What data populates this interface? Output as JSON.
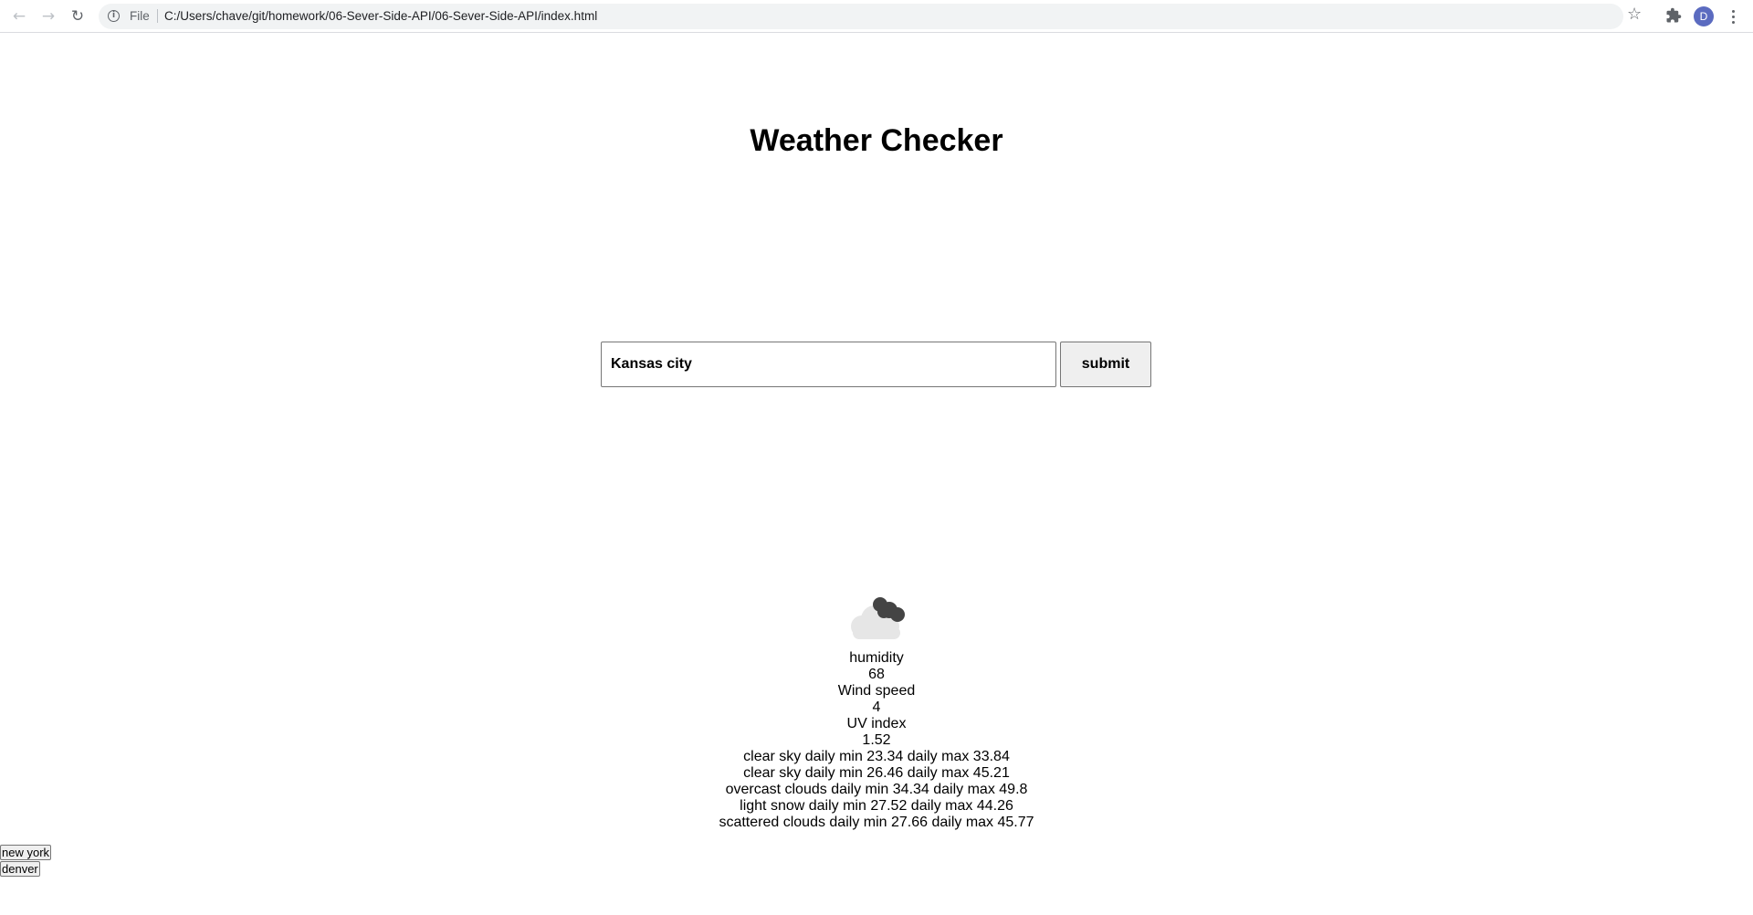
{
  "browser": {
    "scheme_label": "File",
    "url": "C:/Users/chave/git/homework/06-Sever-Side-API/06-Sever-Side-API/index.html",
    "avatar_letter": "D",
    "icons": [
      "back-arrow-icon",
      "forward-arrow-icon",
      "reload-icon",
      "info-icon",
      "star-icon",
      "extensions-icon",
      "menu-icon"
    ]
  },
  "page": {
    "title": "Weather Checker"
  },
  "search": {
    "value": "Kansas city",
    "submit_label": "submit"
  },
  "weather": {
    "icon": "cloud-icon",
    "humidity_label": "humidity",
    "humidity_value": "68",
    "wind_label": "Wind speed",
    "wind_value": "4",
    "uv_label": "UV index",
    "uv_value": "1.52",
    "forecast": [
      "clear sky daily min 23.34 daily max 33.84",
      "clear sky daily min 26.46 daily max 45.21",
      "overcast clouds daily min 34.34 daily max 49.8",
      "light snow daily min 27.52 daily max 44.26",
      "scattered clouds daily min 27.66 daily max 45.77"
    ]
  },
  "history": {
    "cities": [
      "new york",
      "denver"
    ]
  }
}
